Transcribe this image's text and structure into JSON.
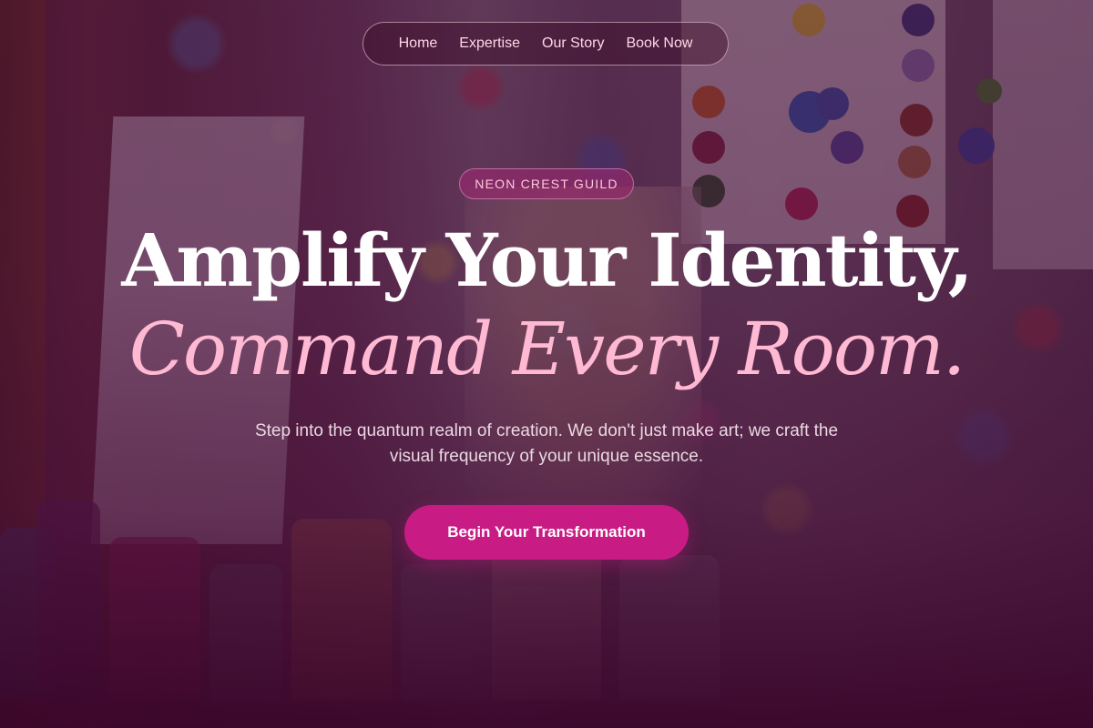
{
  "nav": {
    "items": [
      {
        "label": "Home"
      },
      {
        "label": "Expertise"
      },
      {
        "label": "Our Story"
      },
      {
        "label": "Book Now"
      }
    ]
  },
  "hero": {
    "badge": "NEON CREST GUILD",
    "headline_line1": "Amplify Your Identity,",
    "headline_line2": "Command Every Room.",
    "subtext": "Step into the quantum realm of creation. We don't just make art; we craft the visual frequency of your unique essence.",
    "cta_label": "Begin Your Transformation"
  },
  "colors": {
    "accent": "#c81c84",
    "headline_accent": "#ffb9d2",
    "overlay": "#460e34",
    "nav_text": "#ffd6e6"
  }
}
